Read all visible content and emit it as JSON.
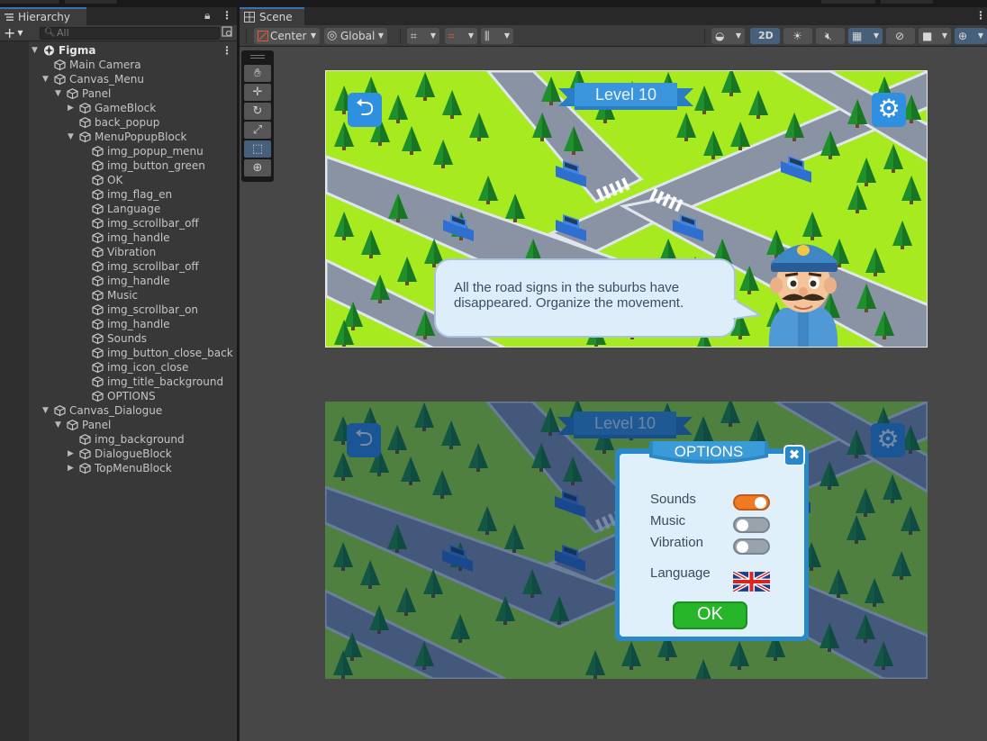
{
  "hierarchy": {
    "tab_label": "Hierarchy",
    "search_placeholder": "All",
    "add_label": "+",
    "items": [
      {
        "label": "Figma",
        "depth": 0,
        "arrow": "down",
        "root": true
      },
      {
        "label": "Main Camera",
        "depth": 1,
        "arrow": ""
      },
      {
        "label": "Canvas_Menu",
        "depth": 1,
        "arrow": "down"
      },
      {
        "label": "Panel",
        "depth": 2,
        "arrow": "down"
      },
      {
        "label": "GameBlock",
        "depth": 3,
        "arrow": "right"
      },
      {
        "label": "back_popup",
        "depth": 3,
        "arrow": ""
      },
      {
        "label": "MenuPopupBlock",
        "depth": 3,
        "arrow": "down"
      },
      {
        "label": "img_popup_menu",
        "depth": 4,
        "arrow": ""
      },
      {
        "label": "img_button_green",
        "depth": 4,
        "arrow": ""
      },
      {
        "label": "OK",
        "depth": 4,
        "arrow": ""
      },
      {
        "label": "img_flag_en",
        "depth": 4,
        "arrow": ""
      },
      {
        "label": "Language",
        "depth": 4,
        "arrow": ""
      },
      {
        "label": "img_scrollbar_off",
        "depth": 4,
        "arrow": ""
      },
      {
        "label": "img_handle",
        "depth": 4,
        "arrow": ""
      },
      {
        "label": "Vibration",
        "depth": 4,
        "arrow": ""
      },
      {
        "label": "img_scrollbar_off",
        "depth": 4,
        "arrow": ""
      },
      {
        "label": "img_handle",
        "depth": 4,
        "arrow": ""
      },
      {
        "label": "Music",
        "depth": 4,
        "arrow": ""
      },
      {
        "label": "img_scrollbar_on",
        "depth": 4,
        "arrow": ""
      },
      {
        "label": "img_handle",
        "depth": 4,
        "arrow": ""
      },
      {
        "label": "Sounds",
        "depth": 4,
        "arrow": ""
      },
      {
        "label": "img_button_close_back",
        "depth": 4,
        "arrow": ""
      },
      {
        "label": "img_icon_close",
        "depth": 4,
        "arrow": ""
      },
      {
        "label": "img_title_background",
        "depth": 4,
        "arrow": ""
      },
      {
        "label": "OPTIONS",
        "depth": 4,
        "arrow": ""
      },
      {
        "label": "Canvas_Dialogue",
        "depth": 1,
        "arrow": "down"
      },
      {
        "label": "Panel",
        "depth": 2,
        "arrow": "down"
      },
      {
        "label": "img_background",
        "depth": 3,
        "arrow": ""
      },
      {
        "label": "DialogueBlock",
        "depth": 3,
        "arrow": "right"
      },
      {
        "label": "TopMenuBlock",
        "depth": 3,
        "arrow": "right"
      }
    ]
  },
  "scene": {
    "tab_label": "Scene",
    "pivot_label": "Center",
    "space_label": "Global",
    "mode_2d_label": "2D"
  },
  "game": {
    "level_label": "Level 10",
    "dialogue_text": "All the road signs in the suburbs have disappeared. Organize the movement."
  },
  "options_popup": {
    "title": "OPTIONS",
    "sounds_label": "Sounds",
    "music_label": "Music",
    "vibration_label": "Vibration",
    "language_label": "Language",
    "ok_label": "OK",
    "sounds_on": true,
    "music_on": false,
    "vibration_on": false
  },
  "colors": {
    "selection_accent": "#3a72b0",
    "game_button_blue": "#2f8fe0",
    "toggle_on": "#f07a22",
    "ok_green": "#27b52a",
    "grass": "#a7ea1f"
  }
}
